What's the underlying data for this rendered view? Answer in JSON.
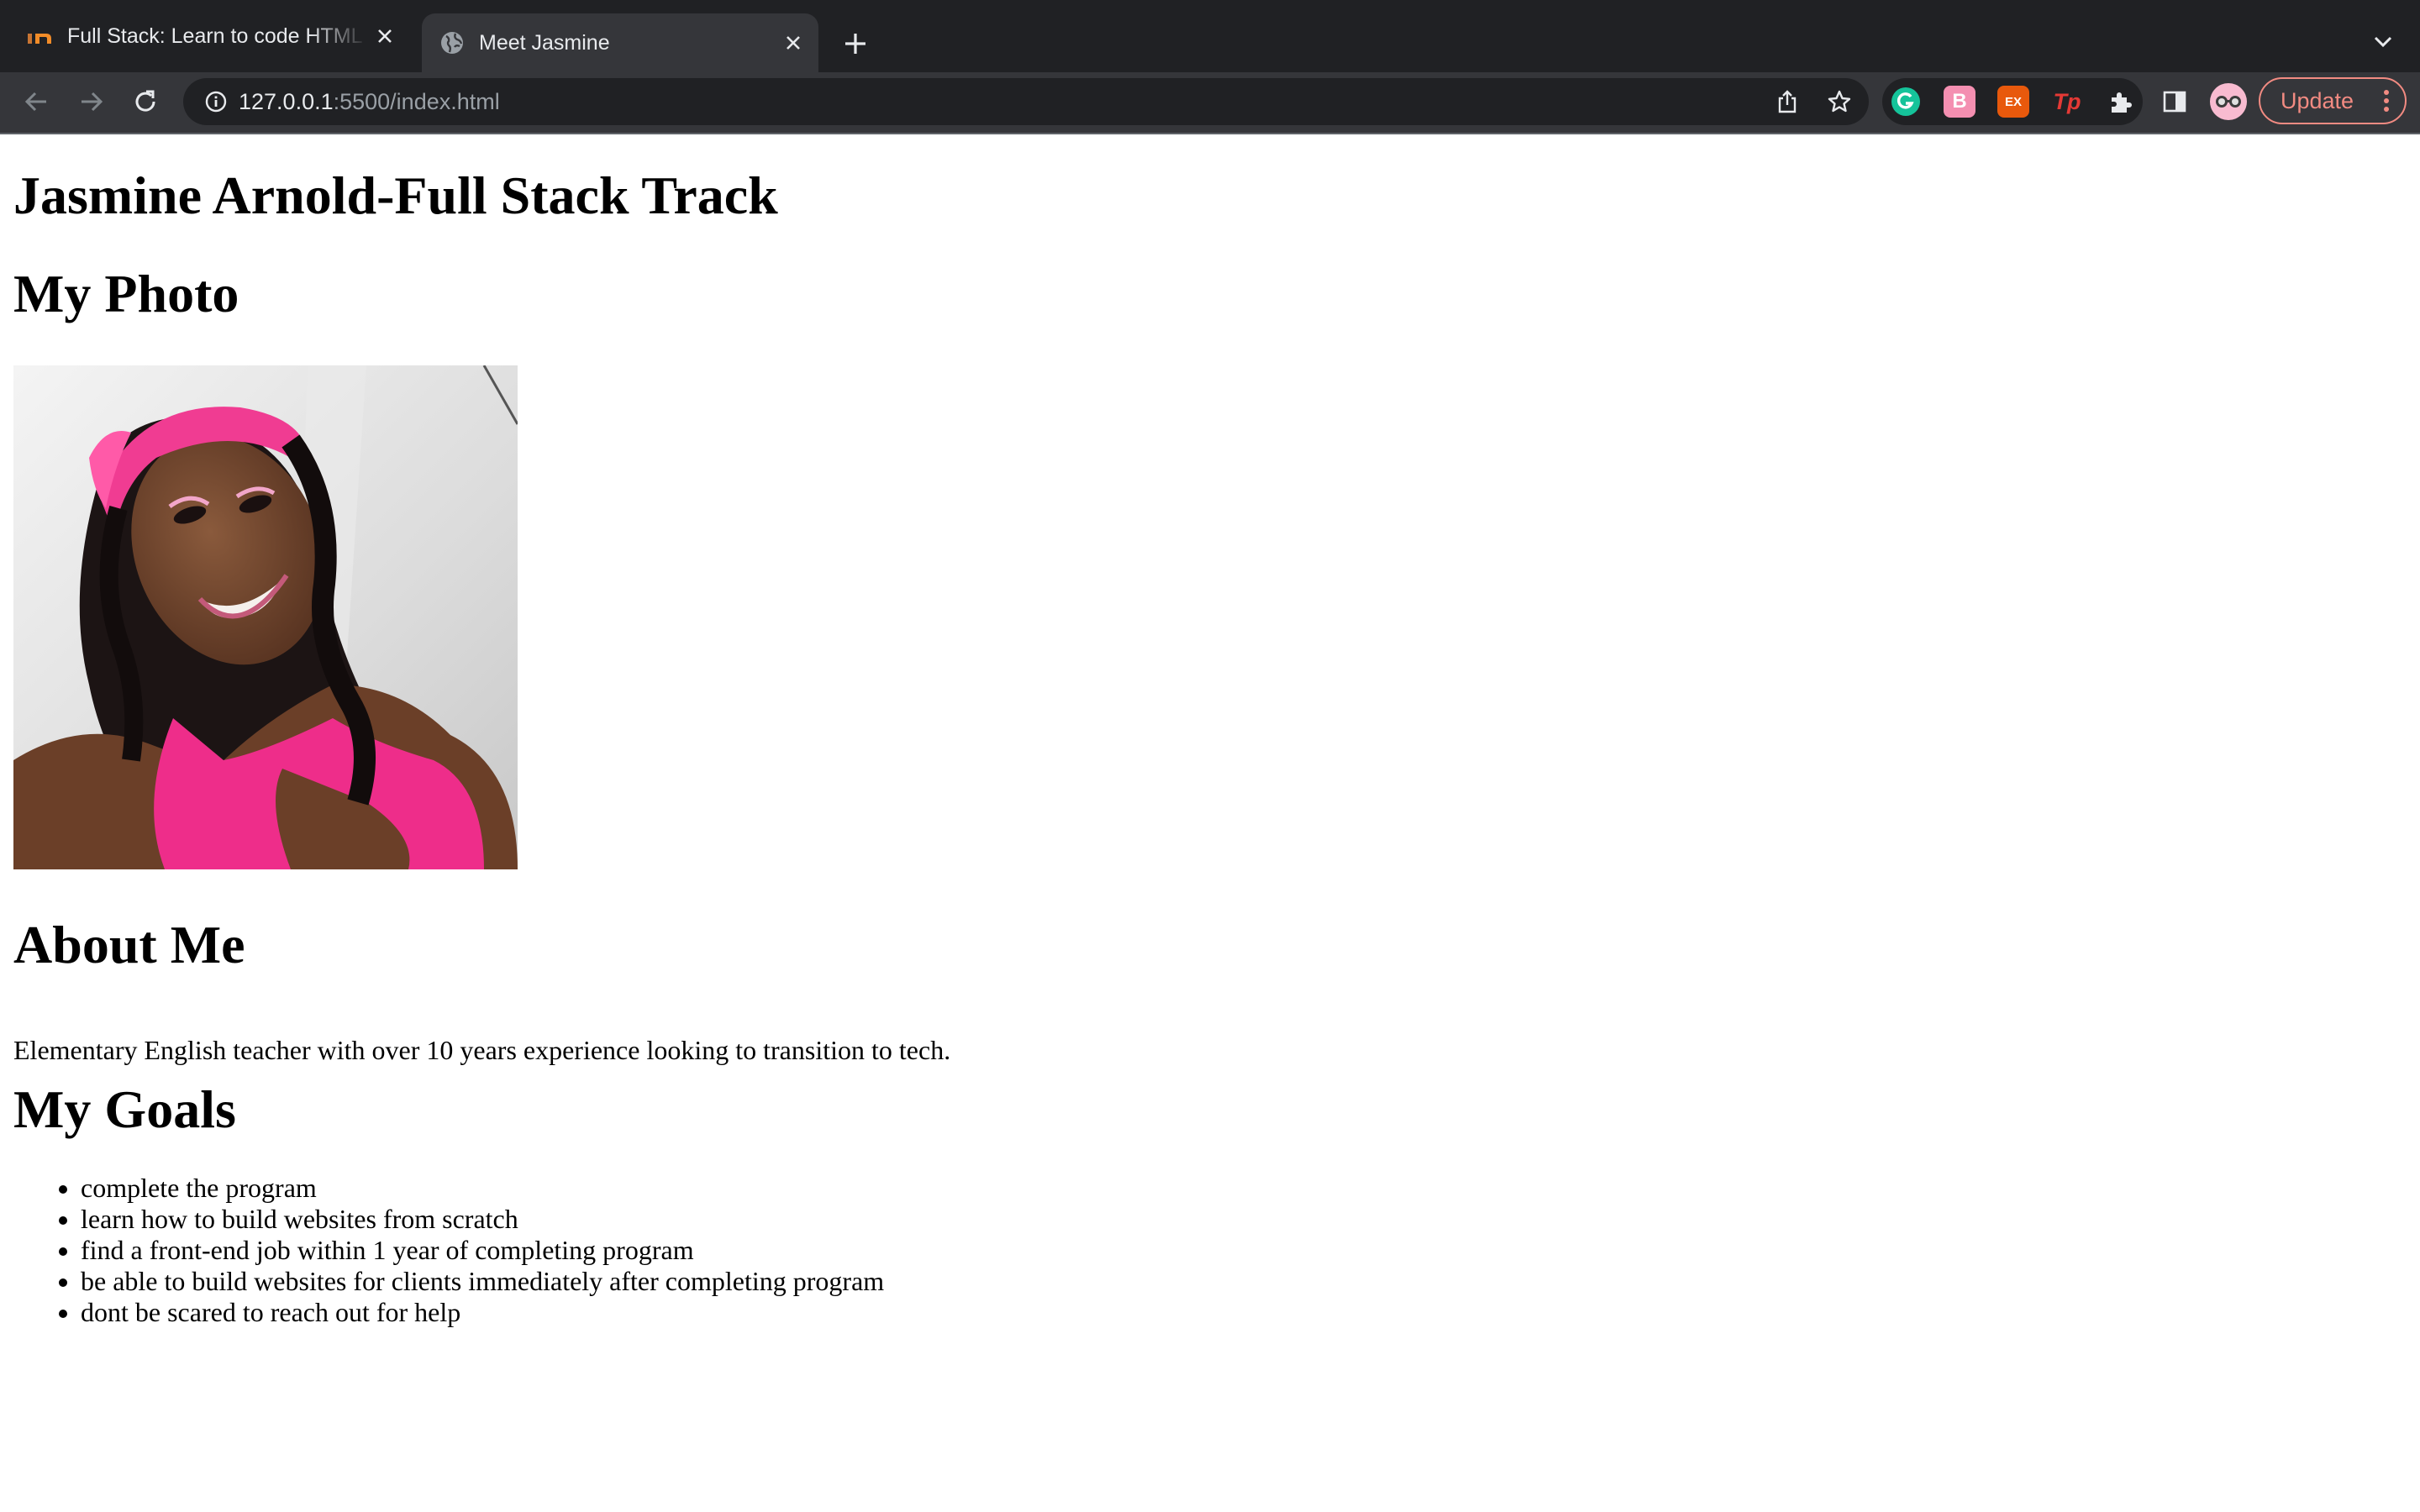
{
  "browser": {
    "tabs": [
      {
        "title": "Full Stack: Learn to code HTML",
        "favicon": "learning-platform-logo-icon",
        "active": false
      },
      {
        "title": "Meet Jasmine",
        "favicon": "globe-icon",
        "active": true
      }
    ],
    "address_bar": {
      "host": "127.0.0.1",
      "rest": ":5500/index.html"
    },
    "extensions": [
      {
        "name": "grammarly-extension-icon",
        "label": "G",
        "color": "#15c39a"
      },
      {
        "name": "b-extension-icon",
        "label": "B",
        "color": "#f48fb1"
      },
      {
        "name": "ex-extension-icon",
        "label": "EX",
        "color": "#e8590c"
      },
      {
        "name": "tp-extension-icon",
        "label": "Tp",
        "color": "#e53935"
      }
    ],
    "update_button": {
      "label": "Update",
      "color": "#f28b82"
    }
  },
  "page": {
    "title": "Jasmine Arnold-Full Stack Track",
    "photo_heading": "My Photo",
    "about_heading": "About Me",
    "about_text": "Elementary English teacher with over 10 years experience looking to transition to tech.",
    "goals_heading": "My Goals",
    "goals": [
      "complete the program",
      "learn how to build websites from scratch",
      "find a front-end job within 1 year of completing program",
      "be able to build websites for clients immediately after completing program",
      "dont be scared to reach out for help"
    ]
  }
}
